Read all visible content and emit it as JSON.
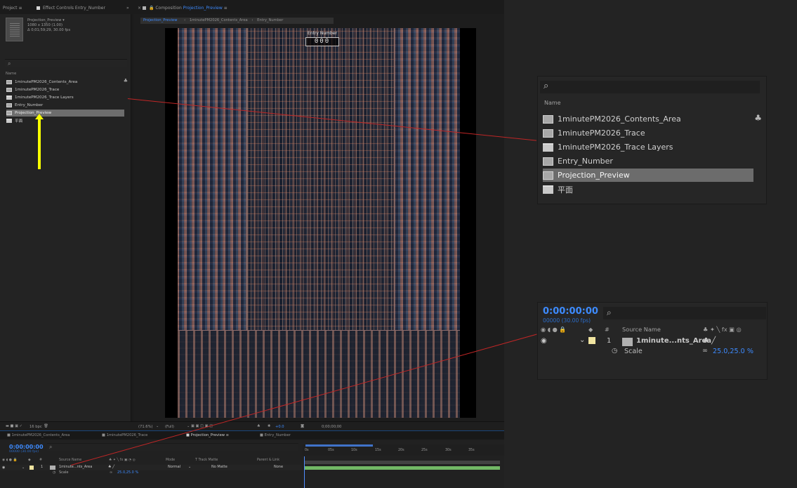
{
  "tabs": {
    "project": "Project",
    "effect_controls": "Effect Controls Entry_Number",
    "composition": "Composition",
    "composition_name": "Projection_Preview",
    "comp_tabs": [
      "Projection_Preview",
      "1minutePM2026_Contents_Area",
      "Entry_Number"
    ]
  },
  "project_panel": {
    "name": "Projection_Preview ▾",
    "size": "1080 x 1350 (1.00)",
    "duration": "Δ 0;01;59;29, 30.00 fps",
    "column_name": "Name",
    "items": [
      "1minutePM2026_Contents_Area",
      "1minutePM2026_Trace",
      "1minutePM2026_Trace Layers",
      "Entry_Number",
      "Projection_Preview",
      "平面"
    ]
  },
  "composition_view": {
    "entry_label": "Entry Number",
    "entry_value": "000"
  },
  "viewer_toolbar": {
    "bits": "16 bpc",
    "zoom": "(71.6%)",
    "resolution": "(Full)",
    "exposure": "+0.0",
    "timecode": "0;00;00;00"
  },
  "timeline_tabs": [
    "1minutePM2026_Contents_Area",
    "1minutePM2026_Trace",
    "Projection_Preview",
    "Entry_Number"
  ],
  "timeline": {
    "time": "0:00:00:00",
    "fps": "00000 (30.00 fps)",
    "headers": {
      "num": "#",
      "source_name": "Source Name",
      "mode": "Mode",
      "track_matte": "T  Track Matte",
      "parent": "Parent & Link"
    },
    "layer": {
      "index": "1",
      "name": "1minute...nts_Area",
      "mode": "Normal",
      "matte": "No Matte",
      "parent": "None"
    },
    "property": {
      "name": "Scale",
      "value": "25.0,25.0 %"
    },
    "ticks": [
      "0s",
      "05s",
      "10s",
      "15s",
      "20s",
      "25s",
      "30s",
      "35s"
    ]
  },
  "zoom_project": {
    "column_name": "Name"
  },
  "zoom_timeline": {
    "time": "0:00:00:00",
    "fps": "00000 (30.00 fps)",
    "num": "#",
    "source_name": "Source Name",
    "layer_index": "1",
    "layer_name": "1minute...nts_Area",
    "property": "Scale",
    "scale_value": "25.0,25.0 %"
  },
  "icons": [
    "search-icon",
    "composition-icon",
    "folder-icon",
    "network-icon",
    "eye-icon",
    "audio-icon",
    "solo-icon",
    "lock-icon",
    "label-icon",
    "stopwatch-icon",
    "chain-link-icon"
  ],
  "colors": {
    "accent": "#3d8bff",
    "annotation": "#c02626",
    "arrow": "#f7ff00",
    "selected": "#6d6d6d"
  }
}
